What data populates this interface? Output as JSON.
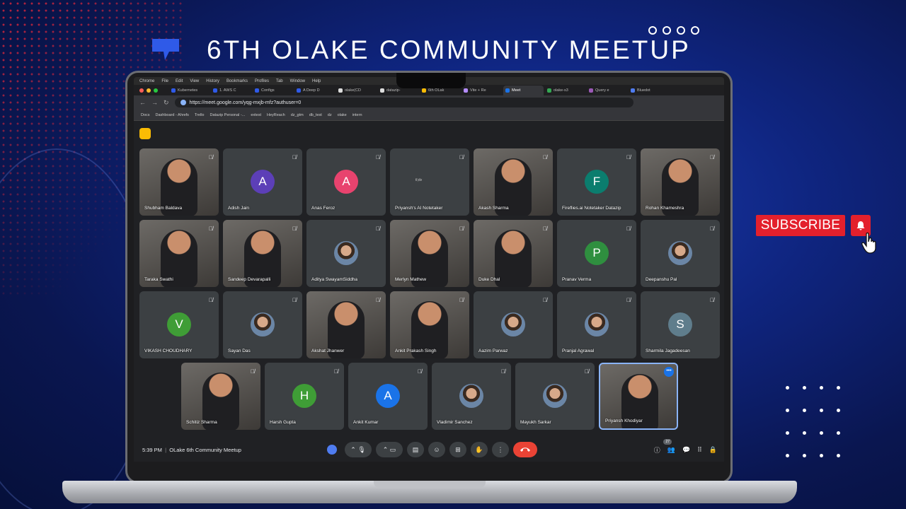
{
  "event": {
    "title": "6TH OLAKE COMMUNITY MEETUP",
    "subscribe_label": "SUBSCRIBE"
  },
  "browser": {
    "menu": [
      "Chrome",
      "File",
      "Edit",
      "View",
      "History",
      "Bookmarks",
      "Profiles",
      "Tab",
      "Window",
      "Help"
    ],
    "tabs": [
      "Kubernetes",
      "1. AWS C",
      "Configs",
      "A Deep D",
      "olake(CD",
      "datazip-",
      "6th OLak",
      "Vite + Re",
      "Meet",
      "olake-s3",
      "Query e",
      "Bluedot"
    ],
    "active_tab": "Meet",
    "url": "https://meet.google.com/yqg-mxjb-mfz?authuser=0",
    "bookmarks": [
      "Docs",
      "Dashboard - Ahrefs",
      "Trello",
      "Datazip Personal -...",
      "extest",
      "HeyReach",
      "dz_gtm",
      "db_test",
      "dz",
      "olake",
      "intern"
    ]
  },
  "meet": {
    "participants": [
      {
        "name": "Shubham Baldava",
        "type": "video"
      },
      {
        "name": "Adish Jain",
        "initial": "A",
        "color": "#5c3fb7"
      },
      {
        "name": "Anas Feroz",
        "initial": "A",
        "color": "#e8436e"
      },
      {
        "name": "Priyansh's AI Notetaker",
        "type": "notetaker",
        "logo_text": "tl;dv"
      },
      {
        "name": "Akash Sharma",
        "type": "video"
      },
      {
        "name": "Fireflies.ai Notetaker Datazip",
        "initial": "F",
        "color": "#0b7d6e"
      },
      {
        "name": "Rohan Khameshra",
        "type": "video"
      },
      {
        "name": "Taraka Swathi",
        "type": "video"
      },
      {
        "name": "Sandeep Devarapalli",
        "type": "video"
      },
      {
        "name": "Aditya SwayamSiddha",
        "type": "photo"
      },
      {
        "name": "Merlyn Mathew",
        "type": "video"
      },
      {
        "name": "Duke Dhal",
        "type": "video"
      },
      {
        "name": "Pranav Verma",
        "initial": "P",
        "color": "#2f8f3f"
      },
      {
        "name": "Deepanshu Pal",
        "type": "photo"
      },
      {
        "name": "VIKASH CHOUDHARY",
        "initial": "V",
        "color": "#3f9d36"
      },
      {
        "name": "Sayan Das",
        "type": "photo"
      },
      {
        "name": "Akshat Jhanwer",
        "type": "video"
      },
      {
        "name": "Ankit Prakash Singh",
        "type": "video"
      },
      {
        "name": "Aazim Parwaz",
        "type": "photo"
      },
      {
        "name": "Pranjal Agrawal",
        "type": "photo"
      },
      {
        "name": "Sharmila Jagadeesan",
        "initial": "S",
        "color": "#5f7d8c"
      },
      {
        "name": "Schitiz Sharma",
        "type": "video"
      },
      {
        "name": "Harsh Gupta",
        "initial": "H",
        "color": "#3f9d36"
      },
      {
        "name": "Ankit Kumar",
        "initial": "A",
        "color": "#1a73e8"
      },
      {
        "name": "Vladimir Sanchez",
        "type": "photo"
      },
      {
        "name": "Mayukh Sarkar",
        "type": "photo"
      },
      {
        "name": "Priyansh Khodiyar",
        "type": "video",
        "selected": true
      }
    ],
    "time": "5:39 PM",
    "meeting_name": "OLake 6th Community Meetup",
    "participant_count": "27"
  }
}
